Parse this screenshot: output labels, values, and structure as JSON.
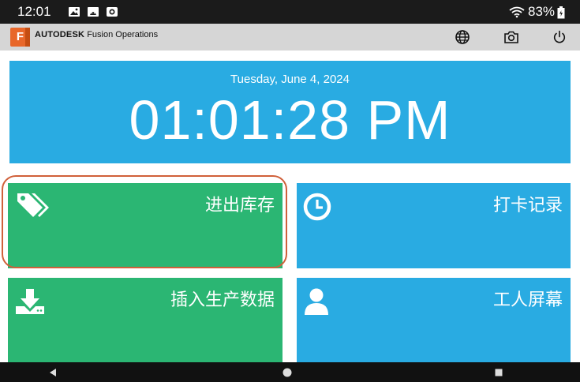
{
  "status_bar": {
    "time": "12:01",
    "battery": "83%",
    "icons": [
      "image-icon",
      "android-debug-icon",
      "record-icon",
      "wifi-icon",
      "battery-icon"
    ]
  },
  "header": {
    "logo_letter": "F",
    "brand": "AUTODESK",
    "product": "Fusion Operations",
    "actions": [
      "globe-icon",
      "camera-icon",
      "power-icon"
    ],
    "color": "#d6d6d6",
    "logo_color": "#e8672a"
  },
  "clock": {
    "date": "Tuesday, June 4, 2024",
    "time": "01:01:28 PM",
    "color": "#29abe2"
  },
  "tiles": [
    {
      "label": "进出库存",
      "icon": "tags-icon",
      "color": "#2bb673",
      "highlighted": true
    },
    {
      "label": "打卡记录",
      "icon": "clock-icon",
      "color": "#29abe2"
    },
    {
      "label": "插入生产数据",
      "icon": "download-icon",
      "color": "#2bb673"
    },
    {
      "label": "工人屏幕",
      "icon": "user-icon",
      "color": "#29abe2"
    }
  ],
  "nav_bar": {
    "buttons": [
      "back-icon",
      "home-icon",
      "recents-icon"
    ]
  }
}
